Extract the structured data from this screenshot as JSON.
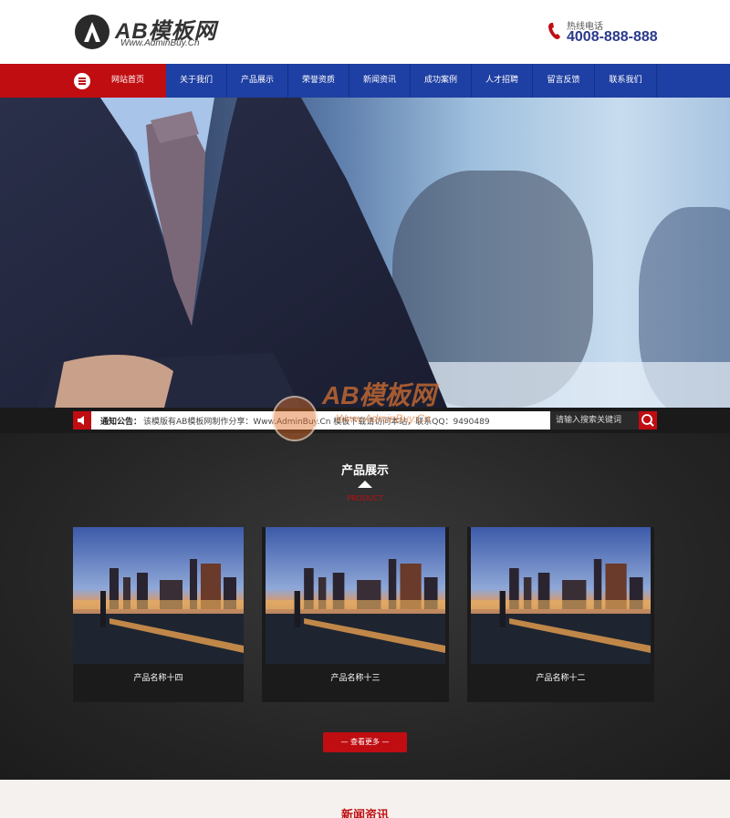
{
  "header": {
    "logo_title": "AB模板网",
    "logo_sub": "Www.AdminBuy.Cn",
    "hotline_label": "热线电话",
    "hotline_number": "4008-888-888"
  },
  "nav": {
    "items": [
      {
        "label": "网站首页"
      },
      {
        "label": "关于我们"
      },
      {
        "label": "产品展示"
      },
      {
        "label": "荣誉资质"
      },
      {
        "label": "新闻资讯"
      },
      {
        "label": "成功案例"
      },
      {
        "label": "人才招聘"
      },
      {
        "label": "留言反馈"
      },
      {
        "label": "联系我们"
      }
    ]
  },
  "notice": {
    "label": "通知公告：",
    "text": "该模版有AB模板网制作分享：Www.AdminBuy.Cn 模板下载请访问本站，联系QQ：9490489",
    "search_placeholder": "请输入搜索关键词"
  },
  "products": {
    "title": "产品展示",
    "subtitle": "PRODUCT",
    "items": [
      {
        "name": "产品名称十四"
      },
      {
        "name": "产品名称十三"
      },
      {
        "name": "产品名称十二"
      }
    ],
    "more_label": "— 查看更多 —"
  },
  "news": {
    "title": "新闻资讯"
  },
  "watermark": {
    "text": "AB模板网",
    "sub": "Www.AdminBuy.Cn"
  },
  "colors": {
    "brand_red": "#c00d12",
    "nav_blue": "#1e3fa3",
    "hotline_blue": "#2a3a8a"
  },
  "icons": [
    "menu-icon",
    "phone-icon",
    "speaker-icon",
    "search-icon"
  ]
}
